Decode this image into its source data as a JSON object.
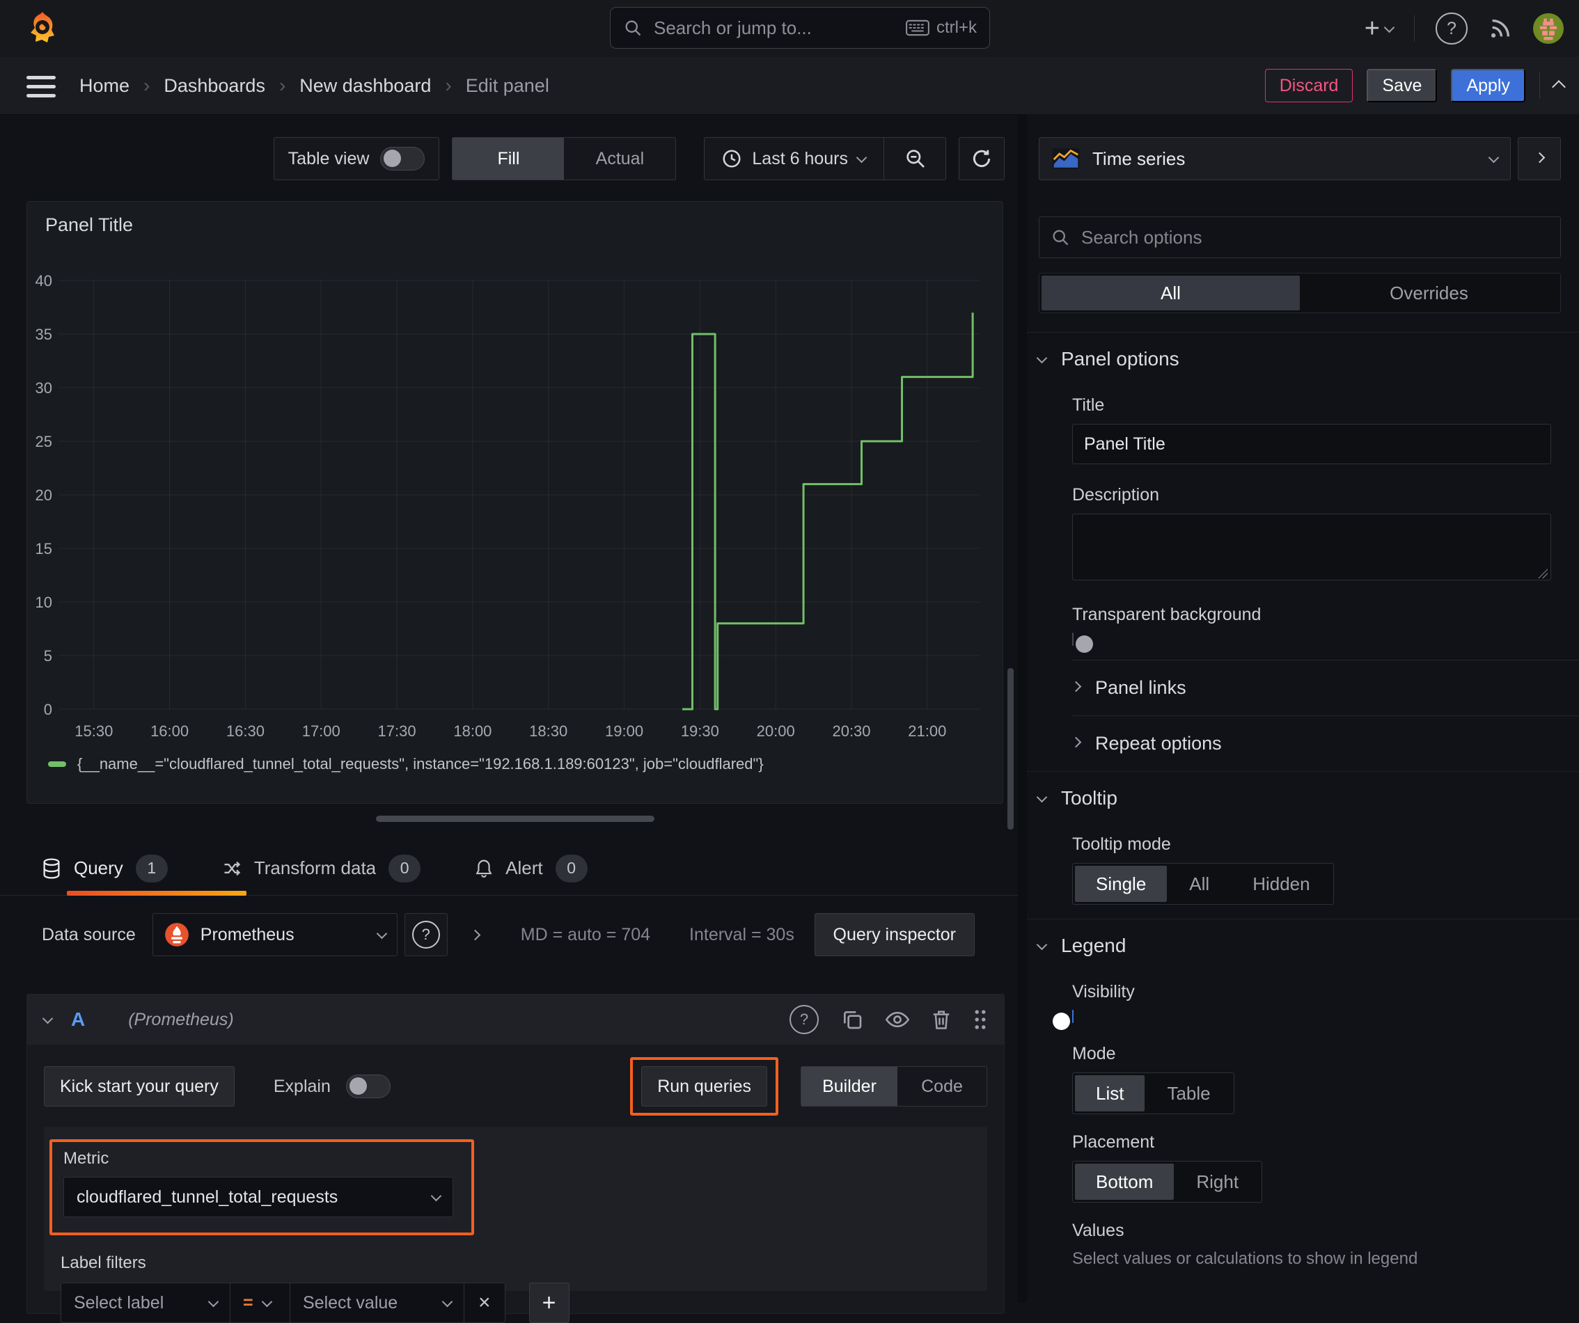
{
  "colors": {
    "accent_orange": "#f55f1e",
    "series_green": "#73bf69",
    "primary_blue": "#3d71d9",
    "danger_pink": "#e0316e"
  },
  "topbar": {
    "search_placeholder": "Search or jump to...",
    "shortcut": "ctrl+k"
  },
  "breadcrumb": {
    "items": [
      "Home",
      "Dashboards",
      "New dashboard",
      "Edit panel"
    ]
  },
  "actions": {
    "discard": "Discard",
    "save": "Save",
    "apply": "Apply"
  },
  "toolbar": {
    "table_view": "Table view",
    "fill": "Fill",
    "actual": "Actual",
    "time_range": "Last 6 hours"
  },
  "panel": {
    "title": "Panel Title"
  },
  "chart_data": {
    "type": "line",
    "stepped": true,
    "title": "Panel Title",
    "x_ticks": [
      "15:30",
      "16:00",
      "16:30",
      "17:00",
      "17:30",
      "18:00",
      "18:30",
      "19:00",
      "19:30",
      "20:00",
      "20:30",
      "21:00"
    ],
    "y_ticks": [
      0,
      5,
      10,
      15,
      20,
      25,
      30,
      35,
      40
    ],
    "ylim": [
      0,
      40
    ],
    "x_window": [
      "15:16",
      "21:21"
    ],
    "grid": true,
    "legend_position": "bottom",
    "series": [
      {
        "name": "{__name__=\"cloudflared_tunnel_total_requests\", instance=\"192.168.1.189:60123\", job=\"cloudflared\"}",
        "color": "#73bf69",
        "points": [
          [
            "19:23",
            0
          ],
          [
            "19:27",
            0
          ],
          [
            "19:27",
            35
          ],
          [
            "19:36",
            35
          ],
          [
            "19:36",
            0
          ],
          [
            "19:37",
            0
          ],
          [
            "19:37",
            8
          ],
          [
            "20:11",
            8
          ],
          [
            "20:11",
            21
          ],
          [
            "20:34",
            21
          ],
          [
            "20:34",
            25
          ],
          [
            "20:50",
            25
          ],
          [
            "20:50",
            31
          ],
          [
            "21:18",
            31
          ],
          [
            "21:18",
            37
          ]
        ]
      }
    ]
  },
  "query_tabs": [
    {
      "label": "Query",
      "count": "1"
    },
    {
      "label": "Transform data",
      "count": "0"
    },
    {
      "label": "Alert",
      "count": "0"
    }
  ],
  "datasource": {
    "label": "Data source",
    "name": "Prometheus",
    "stats": "MD = auto = 704",
    "interval": "Interval = 30s",
    "inspector": "Query inspector"
  },
  "query": {
    "ref_id": "A",
    "ds_hint": "(Prometheus)",
    "kick_start": "Kick start your query",
    "explain": "Explain",
    "run": "Run queries",
    "builder": "Builder",
    "code": "Code",
    "metric_label": "Metric",
    "metric_value": "cloudflared_tunnel_total_requests",
    "filters_label": "Label filters",
    "select_label": "Select label",
    "operator": "=",
    "select_value": "Select value",
    "remove": "×",
    "add": "+"
  },
  "sidebar": {
    "viz": "Time series",
    "search_placeholder": "Search options",
    "filter_tabs": [
      "All",
      "Overrides"
    ],
    "panel_options": {
      "header": "Panel options",
      "title_label": "Title",
      "title_value": "Panel Title",
      "description_label": "Description",
      "transparent_label": "Transparent background"
    },
    "panel_links": "Panel links",
    "repeat_options": "Repeat options",
    "tooltip": {
      "header": "Tooltip",
      "mode_label": "Tooltip mode",
      "options": [
        "Single",
        "All",
        "Hidden"
      ]
    },
    "legend": {
      "header": "Legend",
      "visibility_label": "Visibility",
      "mode_label": "Mode",
      "mode_options": [
        "List",
        "Table"
      ],
      "placement_label": "Placement",
      "placement_options": [
        "Bottom",
        "Right"
      ],
      "values_label": "Values",
      "values_hint": "Select values or calculations to show in legend"
    }
  }
}
